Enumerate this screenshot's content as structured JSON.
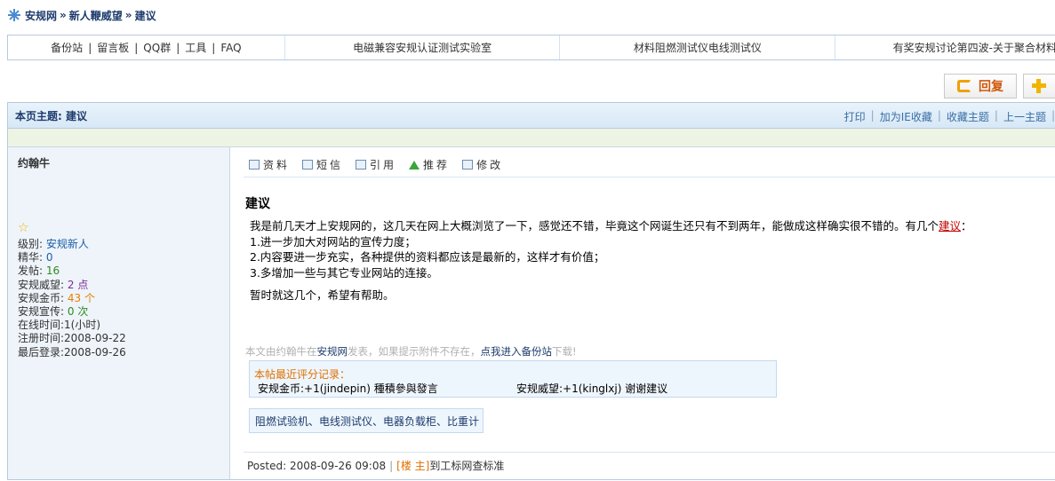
{
  "breadcrumb": {
    "logo_icon": "asterisk-logo-icon",
    "items": [
      "安规网",
      "新人鞭威望",
      "建议"
    ],
    "separator": "»"
  },
  "navbar": {
    "links": [
      "备份站",
      "留言板",
      "QQ群",
      "工具",
      "FAQ"
    ],
    "link_separator": "|",
    "ad1": "电磁兼容安规认证测试实验室",
    "ad2": "材料阻燃测试仪电线测试仪",
    "ad3": "有奖安规讨论第四波-关于聚合材料"
  },
  "actions": {
    "reply_label": "回复",
    "reply_icon": "reply-icon",
    "new_icon": "plus-icon"
  },
  "topic": {
    "heading": "本页主题: 建议",
    "tools": [
      "打印",
      "加为IE收藏",
      "收藏主题",
      "上一主题"
    ],
    "tool_separator": "|"
  },
  "author": {
    "name": "约翰牛",
    "rank_icon": "star-icon",
    "level_label": "级别:",
    "level_value": "安规新人",
    "digest_label": "精华:",
    "digest_value": "0",
    "posts_label": "发帖:",
    "posts_value": "16",
    "prestige_label": "安规威望:",
    "prestige_value": "2 点",
    "coins_label": "安规金币:",
    "coins_value": "43 个",
    "promo_label": "安规宣传:",
    "promo_value": "0 次",
    "online_label": "在线时间:",
    "online_value": "1(小时)",
    "registered_label": "注册时间:",
    "registered_value": "2008-09-22",
    "last_login_label": "最后登录:",
    "last_login_value": "2008-09-26"
  },
  "post_tools": [
    {
      "label": "资料",
      "icon": "profile-icon"
    },
    {
      "label": "短信",
      "icon": "message-icon"
    },
    {
      "label": "引用",
      "icon": "quote-icon"
    },
    {
      "label": "推荐",
      "icon": "recommend-up-arrow-icon"
    },
    {
      "label": "修改",
      "icon": "edit-icon"
    }
  ],
  "post": {
    "title": "建议",
    "line1_prefix": "我是前几天才上安规网的，这几天在网上大概浏览了一下，感觉还不错，毕竟这个网诞生还只有不到两年，能做成这样确实很不错的。有几个",
    "line1_keyword": "建议",
    "line1_suffix": "：",
    "line2": "1.进一步加大对网站的宣传力度；",
    "line3": "2.内容要进一步充实，各种提供的资料都应该是最新的，这样才有价值；",
    "line4": "3.多增加一些与其它专业网站的连接。",
    "line5": "暂时就这几个，希望有帮助。"
  },
  "source_note": {
    "part1": "本文由约翰牛在",
    "site": "安规网",
    "part2": "发表，如果提示附件不存在，",
    "backup_link": "点我进入备份站",
    "part3": "下载!"
  },
  "rating": {
    "title": "本帖最近评分记录：",
    "entry1": "安规金币:+1(jindepin) 種積參與發言",
    "entry2": "安规威望:+1(kinglxj) 谢谢建议"
  },
  "ad_box": {
    "text": "阻燃试验机、电线测试仪、电器负载柜、比重计"
  },
  "footer": {
    "posted_label": "Posted:",
    "posted_time": "2008-09-26 09:08",
    "separator": "|",
    "owner_tag": "[楼 主]",
    "link_text": "到工标网查标准"
  },
  "colors": {
    "accent_blue": "#1d3b6c",
    "link_blue": "#3a6ea5",
    "orange": "#e07000",
    "keyword_red": "#c00000",
    "header_bg": "#d7e8f6",
    "sidebar_bg": "#eef4fa"
  }
}
